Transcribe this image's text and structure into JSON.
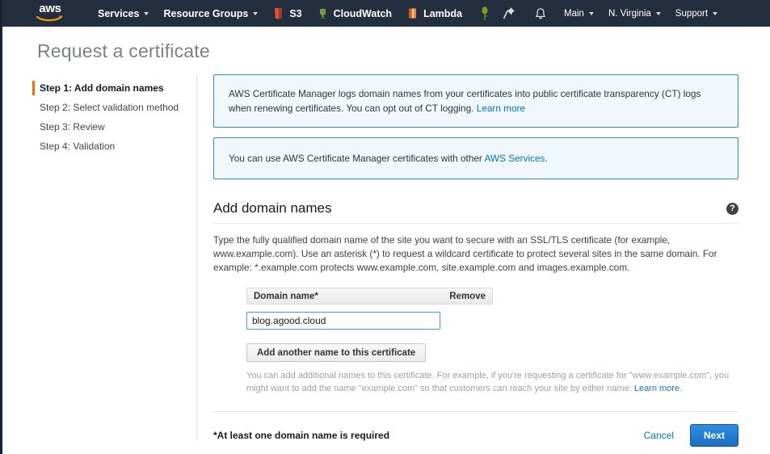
{
  "navbar": {
    "logo_text": "aws",
    "logo_name": "aws-logo",
    "services_label": "Services",
    "resource_groups_label": "Resource Groups",
    "shortcuts": [
      {
        "label": "S3",
        "icon": "s3-icon",
        "color": "#e05243"
      },
      {
        "label": "CloudWatch",
        "icon": "cloudwatch-icon",
        "color": "#759c3e"
      },
      {
        "label": "Lambda",
        "icon": "lambda-icon",
        "color": "#f58536"
      }
    ],
    "pin_icons": [
      {
        "name": "green-pin-icon",
        "color": "#7aa116"
      },
      {
        "name": "white-pin-icon",
        "color": "#d5dbdb"
      }
    ],
    "bell_icon": "notifications-bell-icon",
    "account_label": "Main",
    "region_label": "N. Virginia",
    "support_label": "Support"
  },
  "page": {
    "title": "Request a certificate"
  },
  "sidebar": {
    "steps": [
      {
        "label": "Step 1: Add domain names",
        "active": true
      },
      {
        "label": "Step 2: Select validation method",
        "active": false
      },
      {
        "label": "Step 3: Review",
        "active": false
      },
      {
        "label": "Step 4: Validation",
        "active": false
      }
    ]
  },
  "banners": {
    "ct_logging": {
      "text": "AWS Certificate Manager logs domain names from your certificates into public certificate transparency (CT) logs when renewing certificates. You can opt out of CT logging. ",
      "link": "Learn more"
    },
    "services": {
      "text_before": "You can use AWS Certificate Manager certificates with other ",
      "link": "AWS Services",
      "text_after": "."
    }
  },
  "main": {
    "section_title": "Add domain names",
    "help_icon_glyph": "?",
    "description": "Type the fully qualified domain name of the site you want to secure with an SSL/TLS certificate (for example, www.example.com). Use an asterisk (*) to request a wildcard certificate to protect several sites in the same domain. For example: *.example.com protects www.example.com, site.example.com and images.example.com.",
    "table": {
      "col_domain": "Domain name*",
      "col_remove": "Remove",
      "domain_value": "blog.agood.cloud",
      "domain_placeholder": ""
    },
    "add_another_label": "Add another name to this certificate",
    "helper_text_before": "You can add additional names to this certificate. For example, if you're requesting a certificate for \"www.example.com\", you might want to add the name \"example.com\" so that customers can reach your site by either name. ",
    "helper_link": "Learn more",
    "helper_text_after": "."
  },
  "footer": {
    "required_note": "*At least one domain name is required",
    "cancel_label": "Cancel",
    "next_label": "Next"
  },
  "colors": {
    "nav_bg": "#232f3e",
    "accent_orange": "#ec7211",
    "link_blue": "#0073bb",
    "banner_bg": "#f1f8fd",
    "banner_border": "#3b8ab5",
    "primary_button": "#1b6ec2"
  }
}
